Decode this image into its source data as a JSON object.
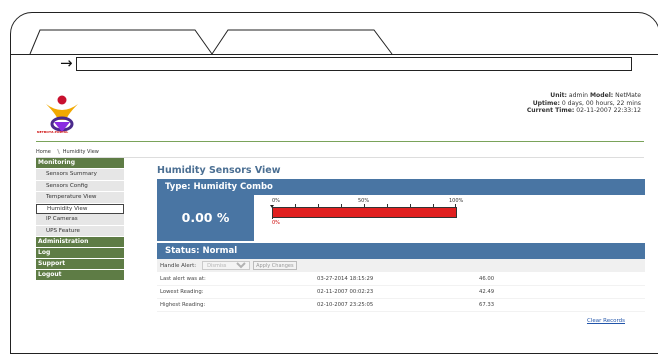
{
  "browser": {
    "back_arrow": "→"
  },
  "header": {
    "unit_label": "Unit:",
    "unit_value": "admin",
    "model_label": "Model:",
    "model_value": "NetMate",
    "uptime_label": "Uptime:",
    "uptime_value": "0 days, 00 hours, 22 mins",
    "time_label": "Current Time:",
    "time_value": "02-11-2007 22:33:12",
    "logo_text": "NETBOTZ-PORTAL"
  },
  "breadcrumb": {
    "home": "Home",
    "current": "Humidity View"
  },
  "sidebar": {
    "sections": [
      {
        "label": "Monitoring"
      },
      {
        "label": "Administration"
      },
      {
        "label": "Log"
      },
      {
        "label": "Support"
      },
      {
        "label": "Logout"
      }
    ],
    "monitoring_items": [
      {
        "label": "Sensors Summary"
      },
      {
        "label": "Sensors Config"
      },
      {
        "label": "Temperature View"
      },
      {
        "label": "Humidity View"
      },
      {
        "label": "IP Cameras"
      },
      {
        "label": "UPS Feature"
      }
    ]
  },
  "main": {
    "title": "Humidity Sensors View",
    "type_header": "Type: Humidity Combo",
    "value_display": "0.00 %",
    "humidity_percent": 0,
    "scale_labels": [
      "0%",
      "50%",
      "100%"
    ],
    "current_label": "0%",
    "status_header": "Status: Normal",
    "handle_alert_label": "Handle Alert:",
    "handle_alert_selected": "Dismiss",
    "apply_button": "Apply Changes",
    "rows": [
      {
        "label": "Last alert was at:",
        "time": "03-27-2014 18:15:29",
        "value": "46.00"
      },
      {
        "label": "Lowest Reading:",
        "time": "02-11-2007 00:02:23",
        "value": "42.49"
      },
      {
        "label": "Highest Reading:",
        "time": "02-10-2007 23:25:05",
        "value": "67.33"
      }
    ],
    "clear_records": "Clear Records"
  },
  "colors": {
    "header_blue": "#4975a3",
    "sidebar_green": "#5e7c45",
    "gauge_red": "#e02020"
  }
}
